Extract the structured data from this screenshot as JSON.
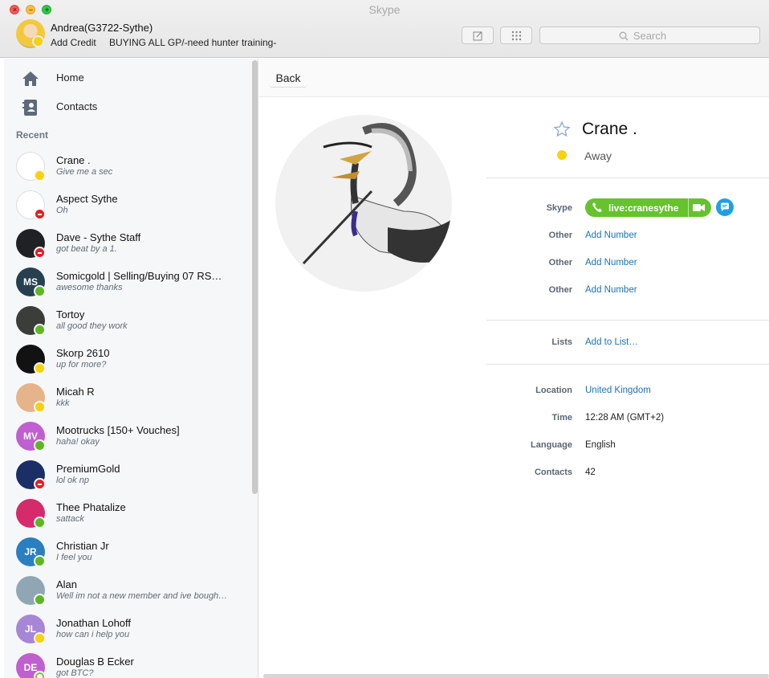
{
  "window": {
    "title": "Skype"
  },
  "header": {
    "user_name": "Andrea(G3722-Sythe)",
    "add_credit": "Add Credit",
    "mood": "BUYING ALL GP/-need hunter training-",
    "search_placeholder": "Search",
    "compose_icon": "compose-icon",
    "dialpad_icon": "dialpad-icon"
  },
  "sidebar": {
    "nav": [
      {
        "label": "Home",
        "icon": "home-icon"
      },
      {
        "label": "Contacts",
        "icon": "contacts-book-icon"
      }
    ],
    "recent_header": "Recent",
    "contacts": [
      {
        "name": "Crane .",
        "message": "Give me a sec",
        "status": "away",
        "initials": "",
        "color": "#ffffff"
      },
      {
        "name": "Aspect Sythe",
        "message": "Oh",
        "status": "dnd",
        "initials": "",
        "color": "#ffffff"
      },
      {
        "name": "Dave - Sythe Staff",
        "message": "got beat by a 1.",
        "status": "dnd",
        "initials": "",
        "color": "#1f2125"
      },
      {
        "name": "Somicgold  | Selling/Buying 07 RS…",
        "message": "awesome thanks",
        "status": "online",
        "initials": "MS",
        "color": "#26404f"
      },
      {
        "name": "Tortoy",
        "message": "all good they work",
        "status": "online",
        "initials": "",
        "color": "#3a3d3a"
      },
      {
        "name": "Skorp 2610",
        "message": "up for more?",
        "status": "away",
        "initials": "",
        "color": "#121212"
      },
      {
        "name": "Micah R",
        "message": "kkk",
        "status": "away",
        "initials": "",
        "color": "#e6b48a"
      },
      {
        "name": "Mootrucks [150+ Vouches]",
        "message": "haha! okay",
        "status": "online",
        "initials": "MV",
        "color": "#c05fcf"
      },
      {
        "name": "PremiumGold",
        "message": "lol ok np",
        "status": "dnd",
        "initials": "",
        "color": "#1b2f66"
      },
      {
        "name": "Thee Phatalize",
        "message": "sattack",
        "status": "online",
        "initials": "",
        "color": "#d52a6b"
      },
      {
        "name": "Christian Jr",
        "message": "I feel you",
        "status": "online",
        "initials": "JR",
        "color": "#2a7fc1"
      },
      {
        "name": "Alan",
        "message": "Well im not a new member and ive bough…",
        "status": "online",
        "initials": "",
        "color": "#8fa7b5"
      },
      {
        "name": "Jonathan Lohoff",
        "message": "how can i help you",
        "status": "away",
        "initials": "JL",
        "color": "#a886d6"
      },
      {
        "name": "Douglas B Ecker",
        "message": "got BTC?",
        "status": "offline",
        "initials": "DE",
        "color": "#c05fcf"
      }
    ]
  },
  "main": {
    "back_label": "Back",
    "profile": {
      "name": "Crane .",
      "status": "Away",
      "skype_label": "Skype",
      "skype_id": "live:cranesythe",
      "phones": [
        {
          "label": "Other",
          "value": "Add Number"
        },
        {
          "label": "Other",
          "value": "Add Number"
        },
        {
          "label": "Other",
          "value": "Add Number"
        }
      ],
      "lists_label": "Lists",
      "lists_value": "Add to List…",
      "details": [
        {
          "label": "Location",
          "value": "United Kingdom",
          "link": true
        },
        {
          "label": "Time",
          "value": "12:28 AM (GMT+2)",
          "link": false
        },
        {
          "label": "Language",
          "value": "English",
          "link": false
        },
        {
          "label": "Contacts",
          "value": "42",
          "link": false
        }
      ]
    }
  },
  "colors": {
    "skype_green": "#66c22d",
    "skype_blue": "#1da1e3",
    "link_blue": "#1a73b8",
    "away_yellow": "#f8d10f",
    "dnd_red": "#e01f26"
  }
}
